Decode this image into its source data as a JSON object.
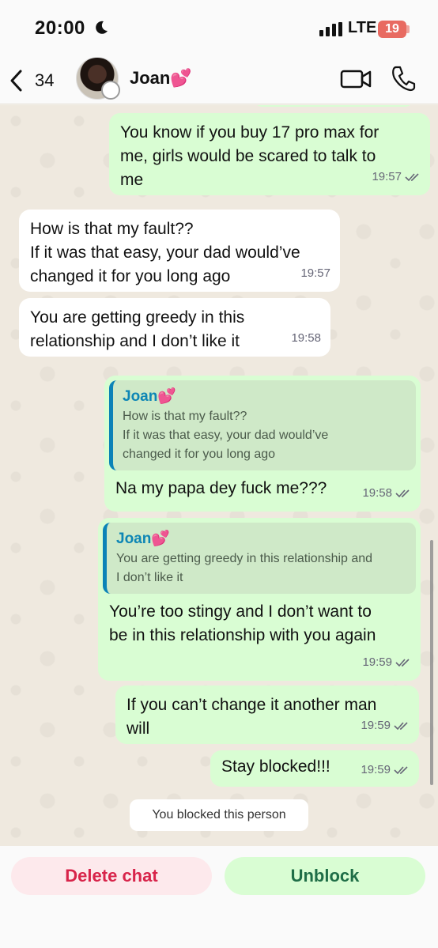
{
  "status_bar": {
    "time": "20:00",
    "network": "LTE",
    "battery": "19"
  },
  "header": {
    "back_count": "34",
    "contact_name": "Joan💕"
  },
  "messages": [
    {
      "text": "You know if you buy 17 pro max for\nme, girls would be scared to talk to\nme",
      "time": "19:57"
    },
    {
      "text": "How is that my fault??\nIf it was that easy, your dad would’ve\nchanged it for you long ago",
      "time": "19:57"
    },
    {
      "text": "You are getting greedy in this\nrelationship and I don’t like it",
      "time": "19:58"
    },
    {
      "quote_name": "Joan💕",
      "quote_text": "How is that my fault??\nIf it was that easy, your dad would’ve\nchanged it for you long ago",
      "text": "Na my papa dey fuck me???",
      "time": "19:58"
    },
    {
      "quote_name": "Joan💕",
      "quote_text": "You are getting greedy in this relationship and\nI don’t like it",
      "text": "You’re too stingy and I don’t want to\nbe in this relationship with you again",
      "time": "19:59"
    },
    {
      "text": "If you can’t change it another man\nwill",
      "time": "19:59"
    },
    {
      "text": "Stay blocked!!!",
      "time": "19:59"
    }
  ],
  "system_note": "You blocked this person",
  "actions": {
    "delete": "Delete chat",
    "unblock": "Unblock"
  },
  "colors": {
    "outgoing": "#d9fdd3",
    "incoming": "#ffffff",
    "quote_accent": "#0b83b7",
    "delete": "#d8244a",
    "unblock": "#1f6e47"
  },
  "icons": [
    "moon-icon",
    "signal-icon",
    "back-chevron-icon",
    "video-call-icon",
    "phone-icon",
    "double-check-icon"
  ]
}
